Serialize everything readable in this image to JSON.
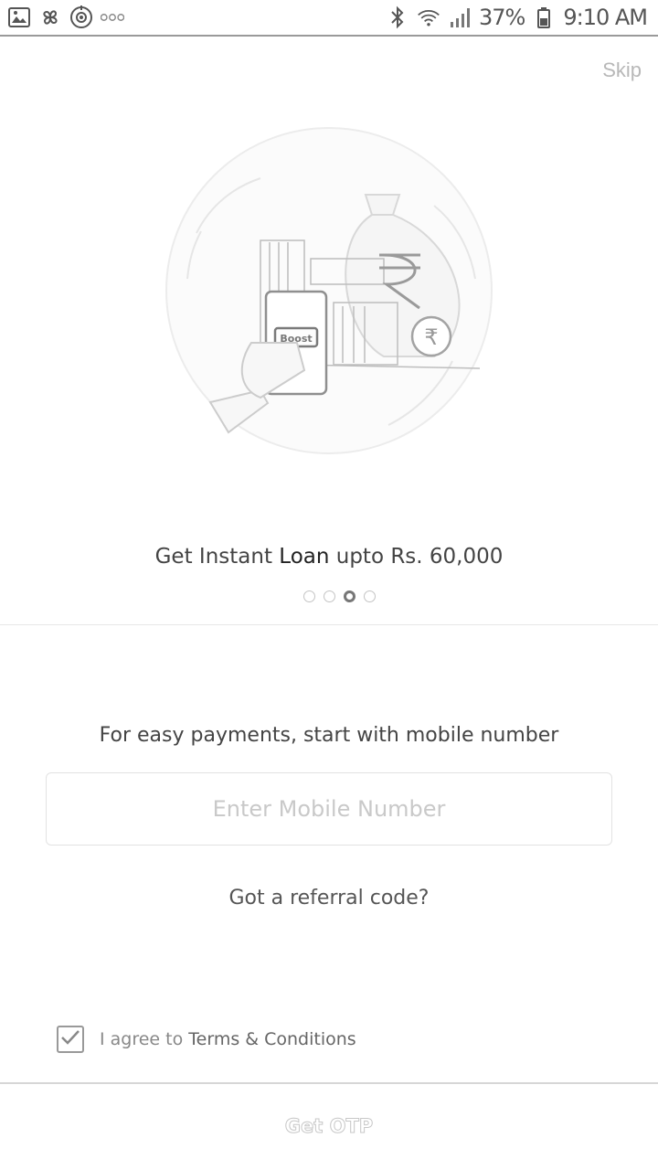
{
  "status_bar": {
    "left_icons": [
      "gallery-icon",
      "pinwheel-icon",
      "target-icon",
      "more-dots-icon"
    ],
    "right_icons": [
      "bluetooth-icon",
      "wifi-icon",
      "signal-icon"
    ],
    "battery": "37%",
    "time": "9:10 AM"
  },
  "onboarding": {
    "skip_label": "Skip",
    "headline_prefix": "Get Instant ",
    "headline_emphasis": "Loan",
    "headline_suffix": " upto Rs. 60,000",
    "illustration_badge": "Boost",
    "carousel": {
      "total_pages": 4,
      "active_index": 2
    }
  },
  "signup": {
    "prompt": "For easy payments, start with mobile number",
    "mobile_placeholder": "Enter Mobile Number",
    "mobile_value": "",
    "referral_label": "Got a referral code?"
  },
  "terms": {
    "checked": true,
    "prefix": "I agree to ",
    "link_label": "Terms & Conditions"
  },
  "footer": {
    "button_label": "Get OTP"
  },
  "colors": {
    "text_primary": "#333333",
    "text_muted": "#888888",
    "placeholder": "#c9c9c9",
    "divider": "#d6d6d6"
  }
}
